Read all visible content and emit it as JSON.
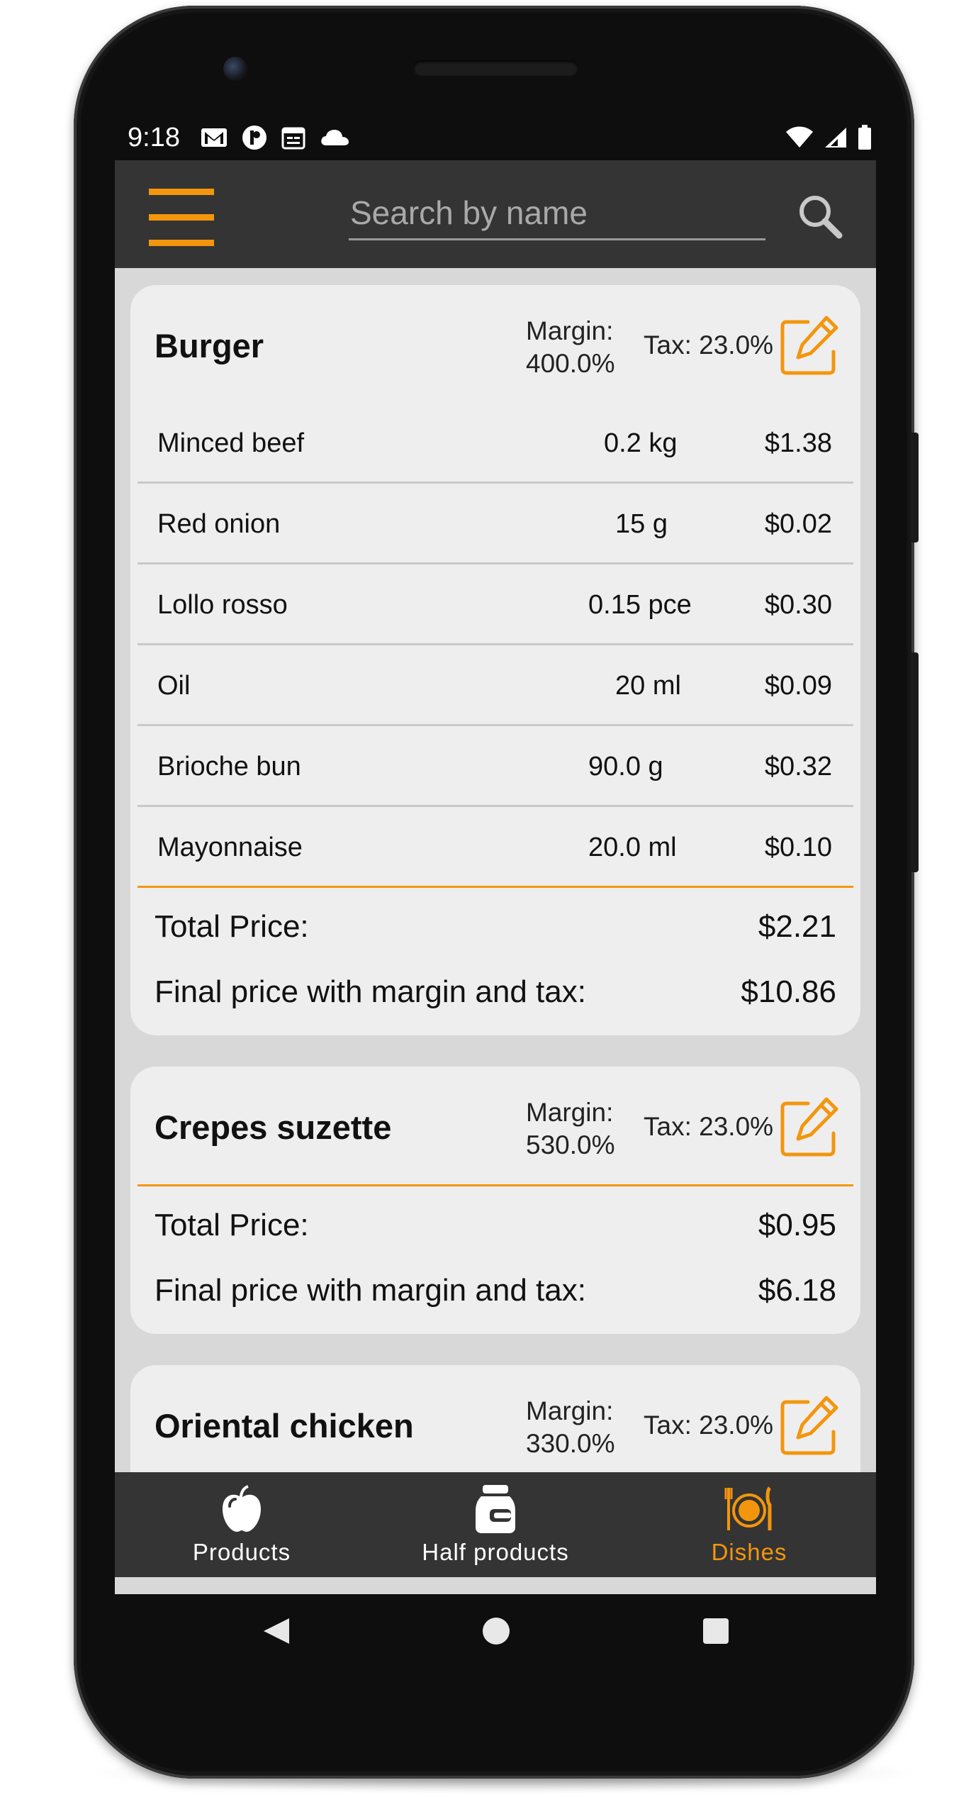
{
  "status_bar": {
    "time": "9:18",
    "left_icons": [
      "gmail-icon",
      "app-icon",
      "calendar-icon",
      "cloud-icon"
    ],
    "right_icons": [
      "wifi-icon",
      "signal-icon",
      "battery-icon"
    ]
  },
  "app_bar": {
    "menu_icon": "hamburger-menu-icon",
    "search": {
      "placeholder": "Search by name",
      "value": ""
    },
    "search_icon": "search-icon"
  },
  "colors": {
    "accent": "#f3960d",
    "app_bar": "#343434",
    "card": "#efeeef",
    "background": "#d8d8d8"
  },
  "dishes": [
    {
      "name": "Burger",
      "margin_label": "Margin:",
      "margin_value": "400.0%",
      "tax": "Tax: 23.0%",
      "ingredients": [
        {
          "name": "Minced beef",
          "quantity": "0.2 kg",
          "price": "$1.38"
        },
        {
          "name": "Red onion",
          "quantity": "15 g",
          "price": "$0.02"
        },
        {
          "name": "Lollo rosso",
          "quantity": "0.15 pce",
          "price": "$0.30"
        },
        {
          "name": "Oil",
          "quantity": "20 ml",
          "price": "$0.09"
        },
        {
          "name": "Brioche bun",
          "quantity": "90.0 g",
          "price": "$0.32"
        },
        {
          "name": "Mayonnaise",
          "quantity": "20.0 ml",
          "price": "$0.10"
        }
      ],
      "total_label": "Total Price:",
      "total_value": "$2.21",
      "final_label": "Final price with margin and tax:",
      "final_value": "$10.86"
    },
    {
      "name": "Crepes suzette",
      "margin_label": "Margin:",
      "margin_value": "530.0%",
      "tax": "Tax: 23.0%",
      "ingredients": [],
      "total_label": "Total Price:",
      "total_value": "$0.95",
      "final_label": "Final price with margin and tax:",
      "final_value": "$6.18"
    },
    {
      "name": "Oriental chicken",
      "margin_label": "Margin:",
      "margin_value": "330.0%",
      "tax": "Tax: 23.0%"
    }
  ],
  "bottom_nav": [
    {
      "label": "Products",
      "icon": "apple-icon",
      "active": false
    },
    {
      "label": "Half products",
      "icon": "jar-icon",
      "active": false
    },
    {
      "label": "Dishes",
      "icon": "plate-cutlery-icon",
      "active": true
    }
  ],
  "system_nav": [
    "back-icon",
    "home-icon",
    "recents-icon"
  ]
}
